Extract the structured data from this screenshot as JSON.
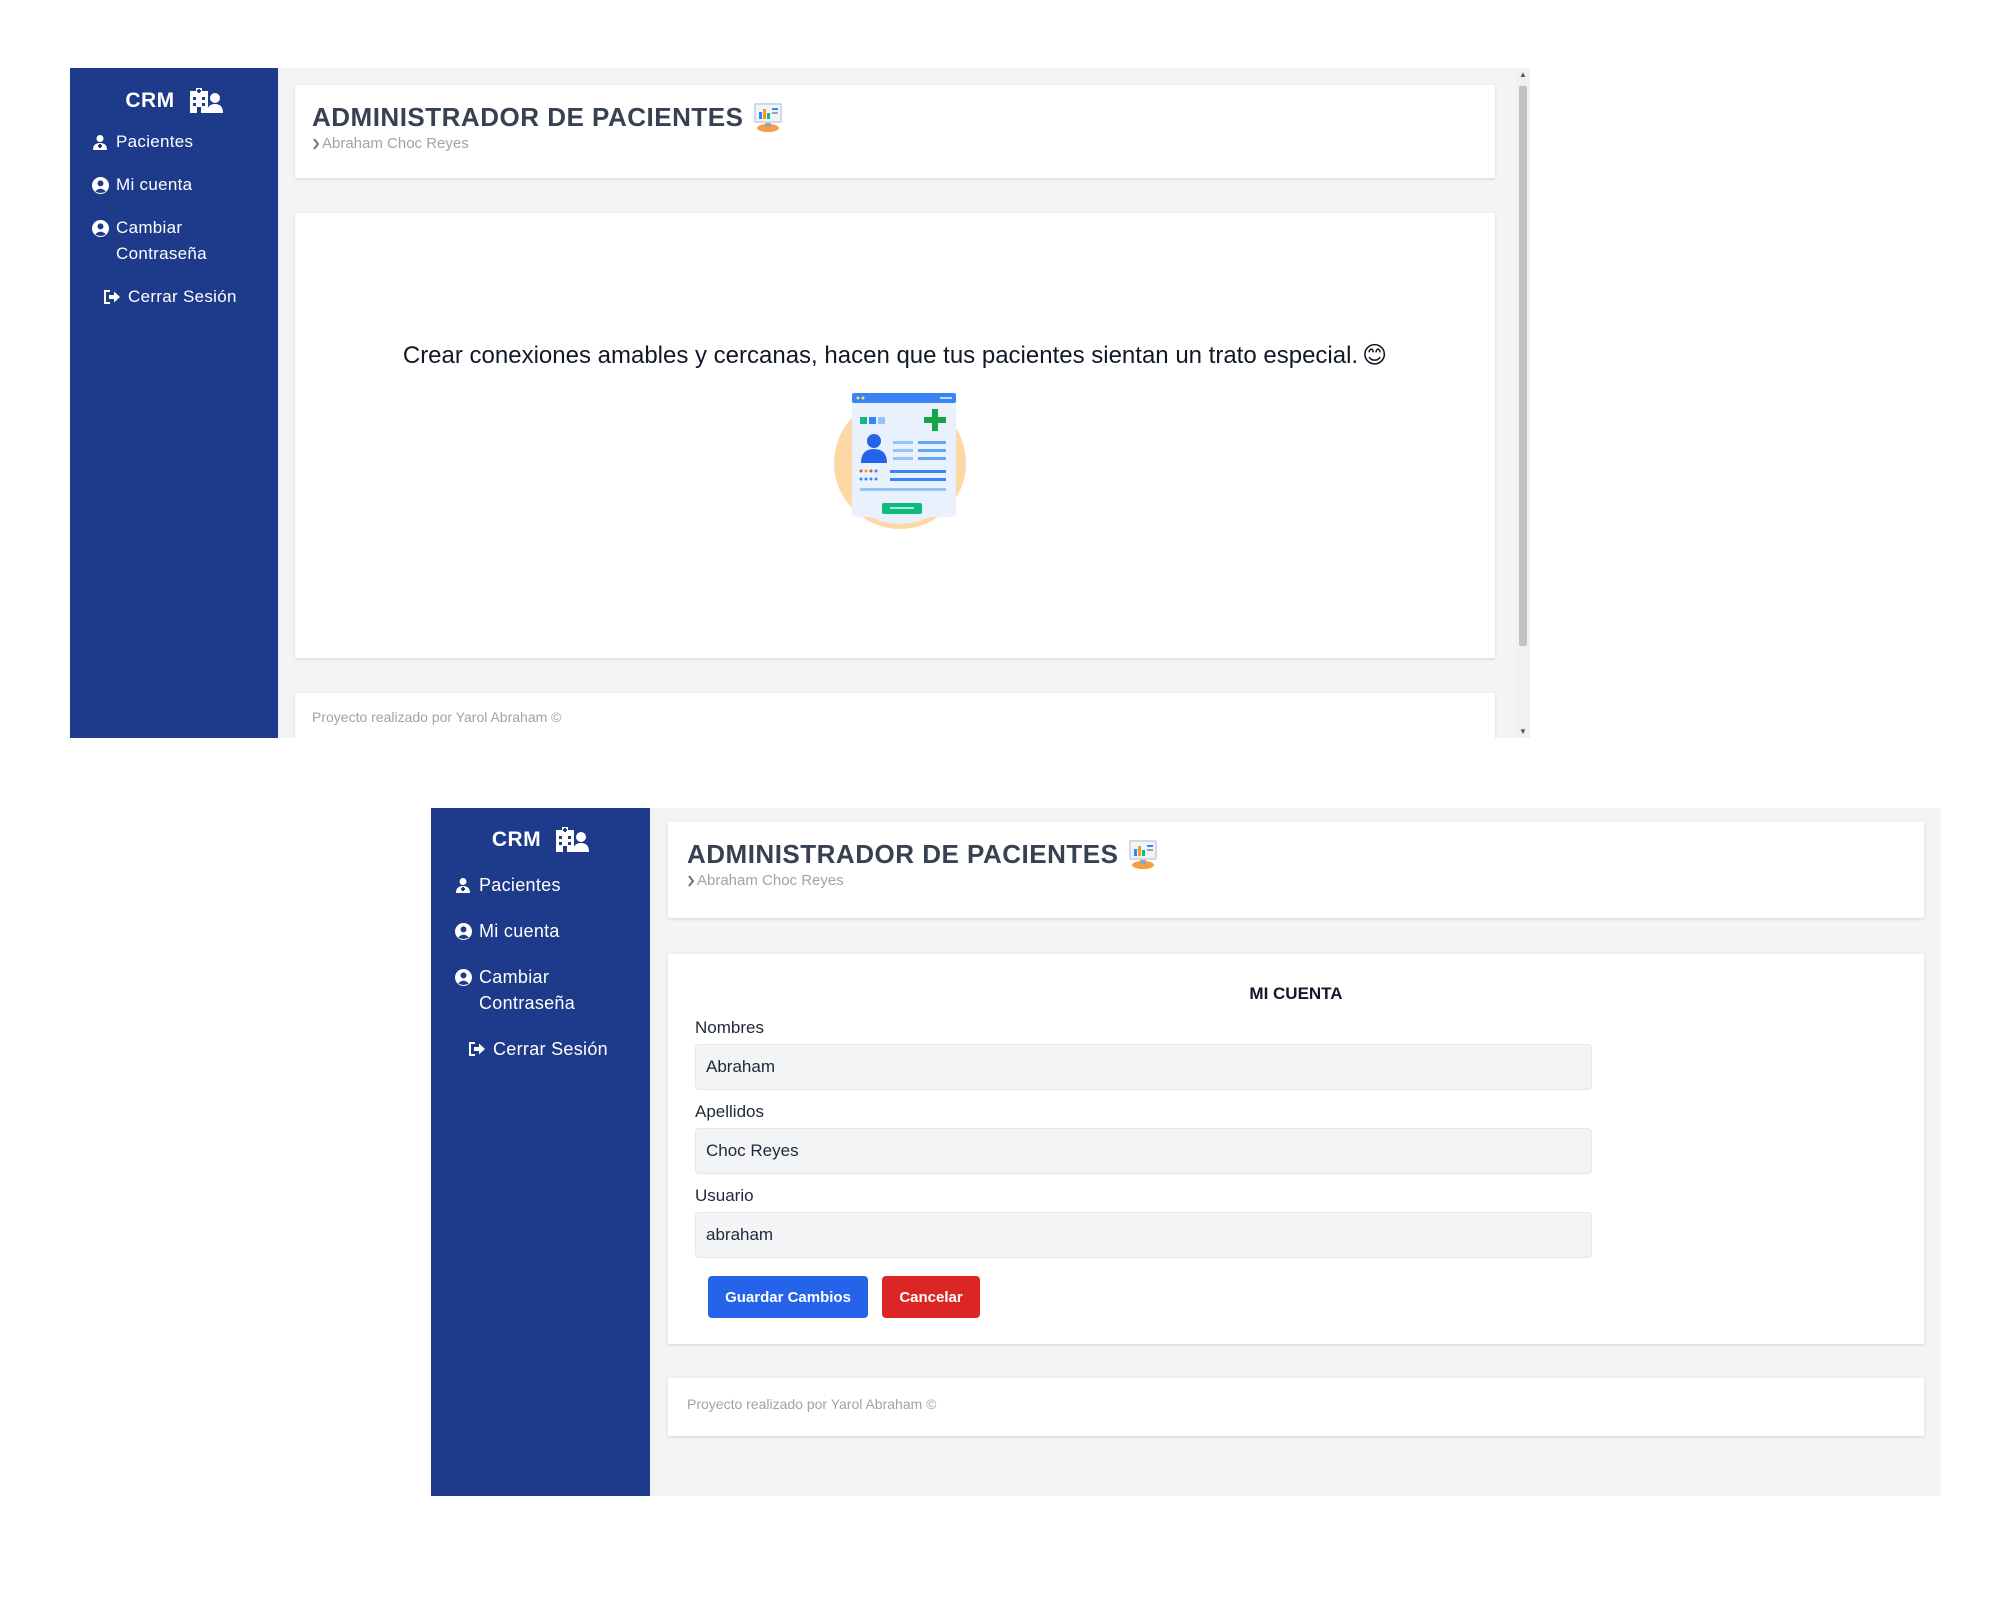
{
  "app": {
    "brand": "CRM",
    "title": "ADMINISTRADOR DE PACIENTES",
    "breadcrumb": "Abraham Choc Reyes",
    "footer": "Proyecto realizado por Yarol Abraham ©"
  },
  "sidebar": {
    "items": [
      {
        "label": "Pacientes",
        "icon": "user-doctor-icon"
      },
      {
        "label": "Mi cuenta",
        "icon": "user-circle-icon"
      },
      {
        "label": "Cambiar Contraseña",
        "icon": "user-circle-icon"
      },
      {
        "label": "Cerrar Sesión",
        "icon": "sign-out-icon"
      }
    ]
  },
  "dashboard": {
    "slogan": "Crear conexiones amables y cercanas, hacen que tus pacientes sientan un trato especial.",
    "slogan_emoji": "😊"
  },
  "account_form": {
    "title": "MI CUENTA",
    "fields": [
      {
        "label": "Nombres",
        "value": "Abraham"
      },
      {
        "label": "Apellidos",
        "value": "Choc Reyes"
      },
      {
        "label": "Usuario",
        "value": "abraham"
      }
    ],
    "save_label": "Guardar Cambios",
    "cancel_label": "Cancelar"
  },
  "colors": {
    "sidebar": "#1e3a8a",
    "primary": "#2563eb",
    "danger": "#dc2626",
    "background": "#f3f4f6"
  }
}
